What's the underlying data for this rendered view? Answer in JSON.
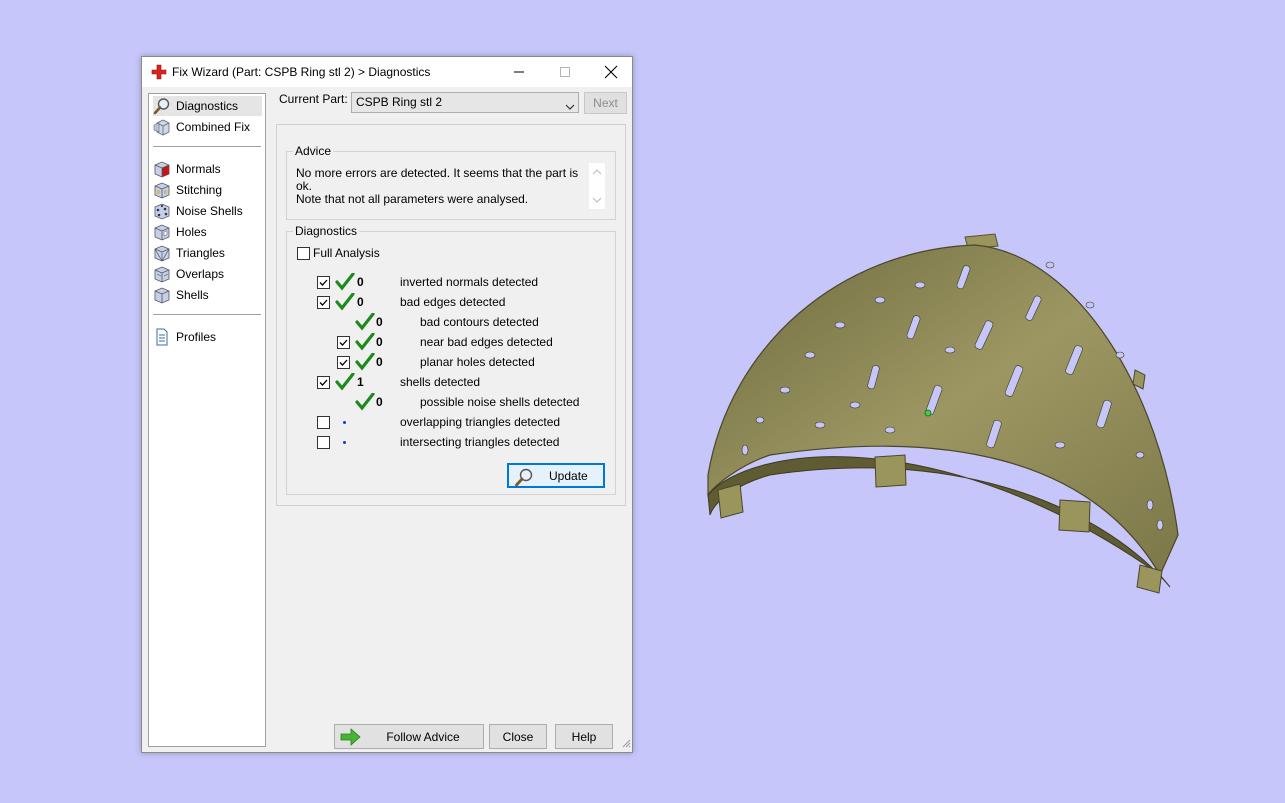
{
  "window": {
    "title": "Fix Wizard (Part: CSPB Ring stl 2) > Diagnostics",
    "icon": "red-cross-icon"
  },
  "sidebar": {
    "items": [
      {
        "label": "Diagnostics",
        "icon": "magnifier-icon",
        "selected": true
      },
      {
        "label": "Combined Fix",
        "icon": "cube-stack-icon"
      },
      {
        "label": "Normals",
        "icon": "cube-normals-icon"
      },
      {
        "label": "Stitching",
        "icon": "cube-stitching-icon"
      },
      {
        "label": "Noise Shells",
        "icon": "cube-noise-icon"
      },
      {
        "label": "Holes",
        "icon": "cube-holes-icon"
      },
      {
        "label": "Triangles",
        "icon": "cube-triangles-icon"
      },
      {
        "label": "Overlaps",
        "icon": "cube-overlaps-icon"
      },
      {
        "label": "Shells",
        "icon": "cube-shells-icon"
      },
      {
        "label": "Profiles",
        "icon": "document-icon"
      }
    ]
  },
  "current_part": {
    "label": "Current Part:",
    "value": "CSPB Ring stl 2",
    "next_label": "Next"
  },
  "advice": {
    "title": "Advice",
    "line1": "No more errors are detected. It seems that the part is ok.",
    "line2": "Note that not all parameters were analysed."
  },
  "diagnostics": {
    "title": "Diagnostics",
    "full_analysis_label": "Full Analysis",
    "full_analysis_checked": false,
    "rows": [
      {
        "checked": true,
        "status": "ok",
        "count": "0",
        "label": "inverted normals detected"
      },
      {
        "checked": true,
        "status": "ok",
        "count": "0",
        "label": "bad edges detected"
      },
      {
        "checked": null,
        "status": "ok",
        "count": "0",
        "label": "bad contours detected"
      },
      {
        "checked": true,
        "status": "ok",
        "count": "0",
        "label": "near bad edges detected"
      },
      {
        "checked": true,
        "status": "ok",
        "count": "0",
        "label": "planar holes detected"
      },
      {
        "checked": true,
        "status": "ok",
        "count": "1",
        "label": "shells detected"
      },
      {
        "checked": null,
        "status": "ok",
        "count": "0",
        "label": "possible noise shells detected"
      },
      {
        "checked": false,
        "status": "not-analysed",
        "count": "",
        "label": "overlapping triangles detected"
      },
      {
        "checked": false,
        "status": "not-analysed",
        "count": "",
        "label": "intersecting triangles detected"
      }
    ],
    "update_label": "Update"
  },
  "buttons": {
    "follow_advice": "Follow Advice",
    "close": "Close",
    "help": "Help"
  },
  "colors": {
    "desktop": "#c6c6fa",
    "model_fill": "#8f8a55",
    "check_green": "#1e8a1e",
    "accent_blue": "#0078d7"
  }
}
